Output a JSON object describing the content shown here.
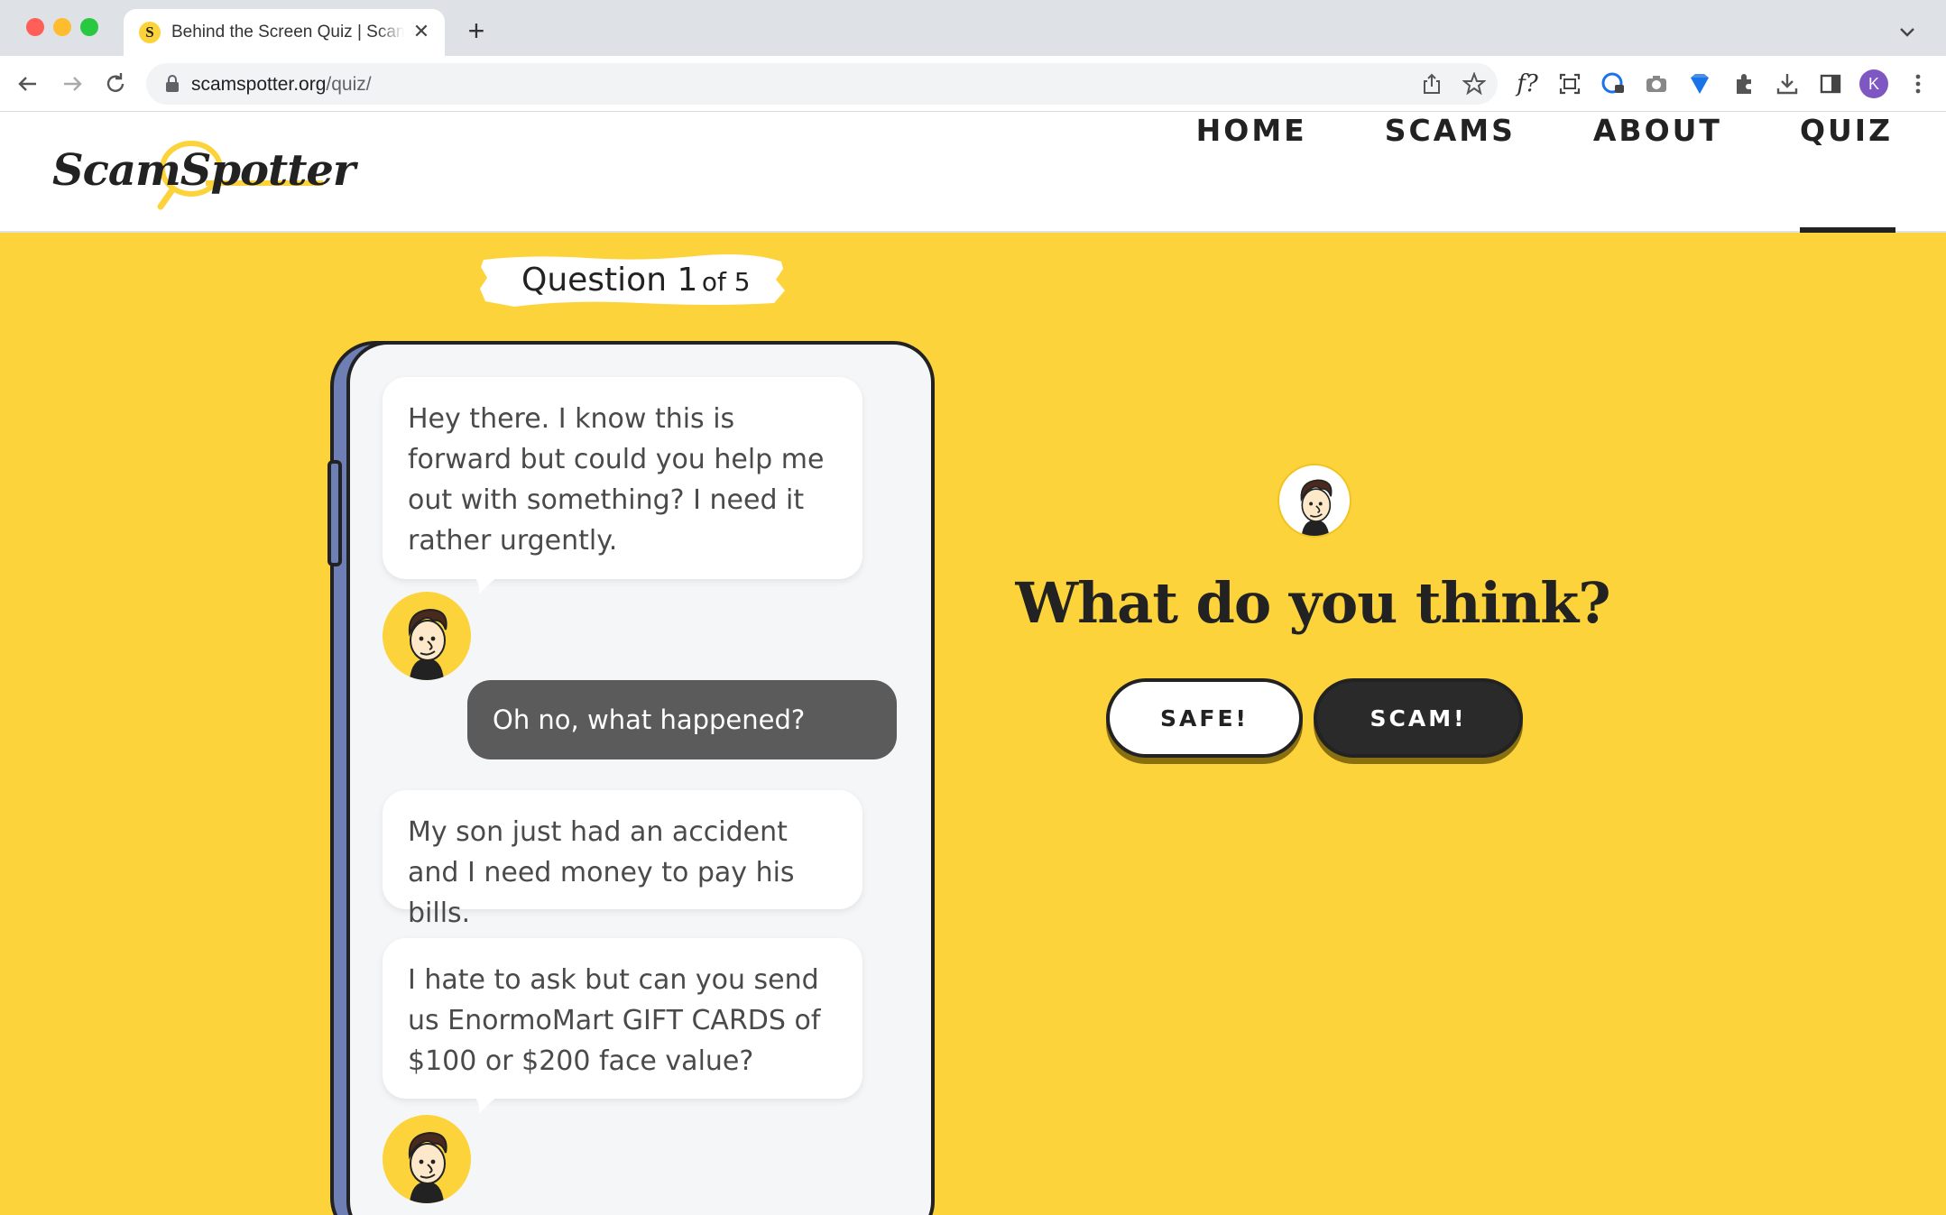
{
  "browser": {
    "tab_title": "Behind the Screen Quiz | ScamSpotter",
    "tab_favicon": "S",
    "new_tab": "+",
    "close_glyph": "✕",
    "url_host": "scamspotter.org",
    "url_path": "/quiz/",
    "profile_initial": "K",
    "icons": [
      "back-icon",
      "forward-icon",
      "reload-icon",
      "share-icon",
      "bookmark-star-icon",
      "font-icon",
      "screenshot-icon",
      "password-icon",
      "camera-icon",
      "gem-icon",
      "extensions-icon",
      "download-icon",
      "sidepanel-icon",
      "menu-dots-icon"
    ]
  },
  "site": {
    "logo": "ScamSpotter",
    "nav": [
      {
        "label": "HOME"
      },
      {
        "label": "SCAMS"
      },
      {
        "label": "ABOUT"
      },
      {
        "label": "QUIZ",
        "active": true
      }
    ]
  },
  "quiz": {
    "question_label": "Question 1",
    "question_of": "of 5",
    "messages": [
      {
        "from": "contact",
        "text": "Hey there. I know this is forward but could you help me out with something? I need it rather urgently."
      },
      {
        "from": "user",
        "text": "Oh no, what happened?"
      },
      {
        "from": "contact",
        "text": "My son just had an accident and I need money to pay his bills."
      },
      {
        "from": "contact",
        "text": "I hate to ask but can you send us EnormoMart GIFT CARDS of $100 or $200 face value?"
      }
    ],
    "prompt": "What do you think?",
    "safe_button": "SAFE!",
    "scam_button": "SCAM!"
  },
  "colors": {
    "page_yellow": "#fcd33a",
    "dark": "#222222",
    "phone_side": "#6d7fb5",
    "reply_bubble": "#5b5b5b"
  }
}
